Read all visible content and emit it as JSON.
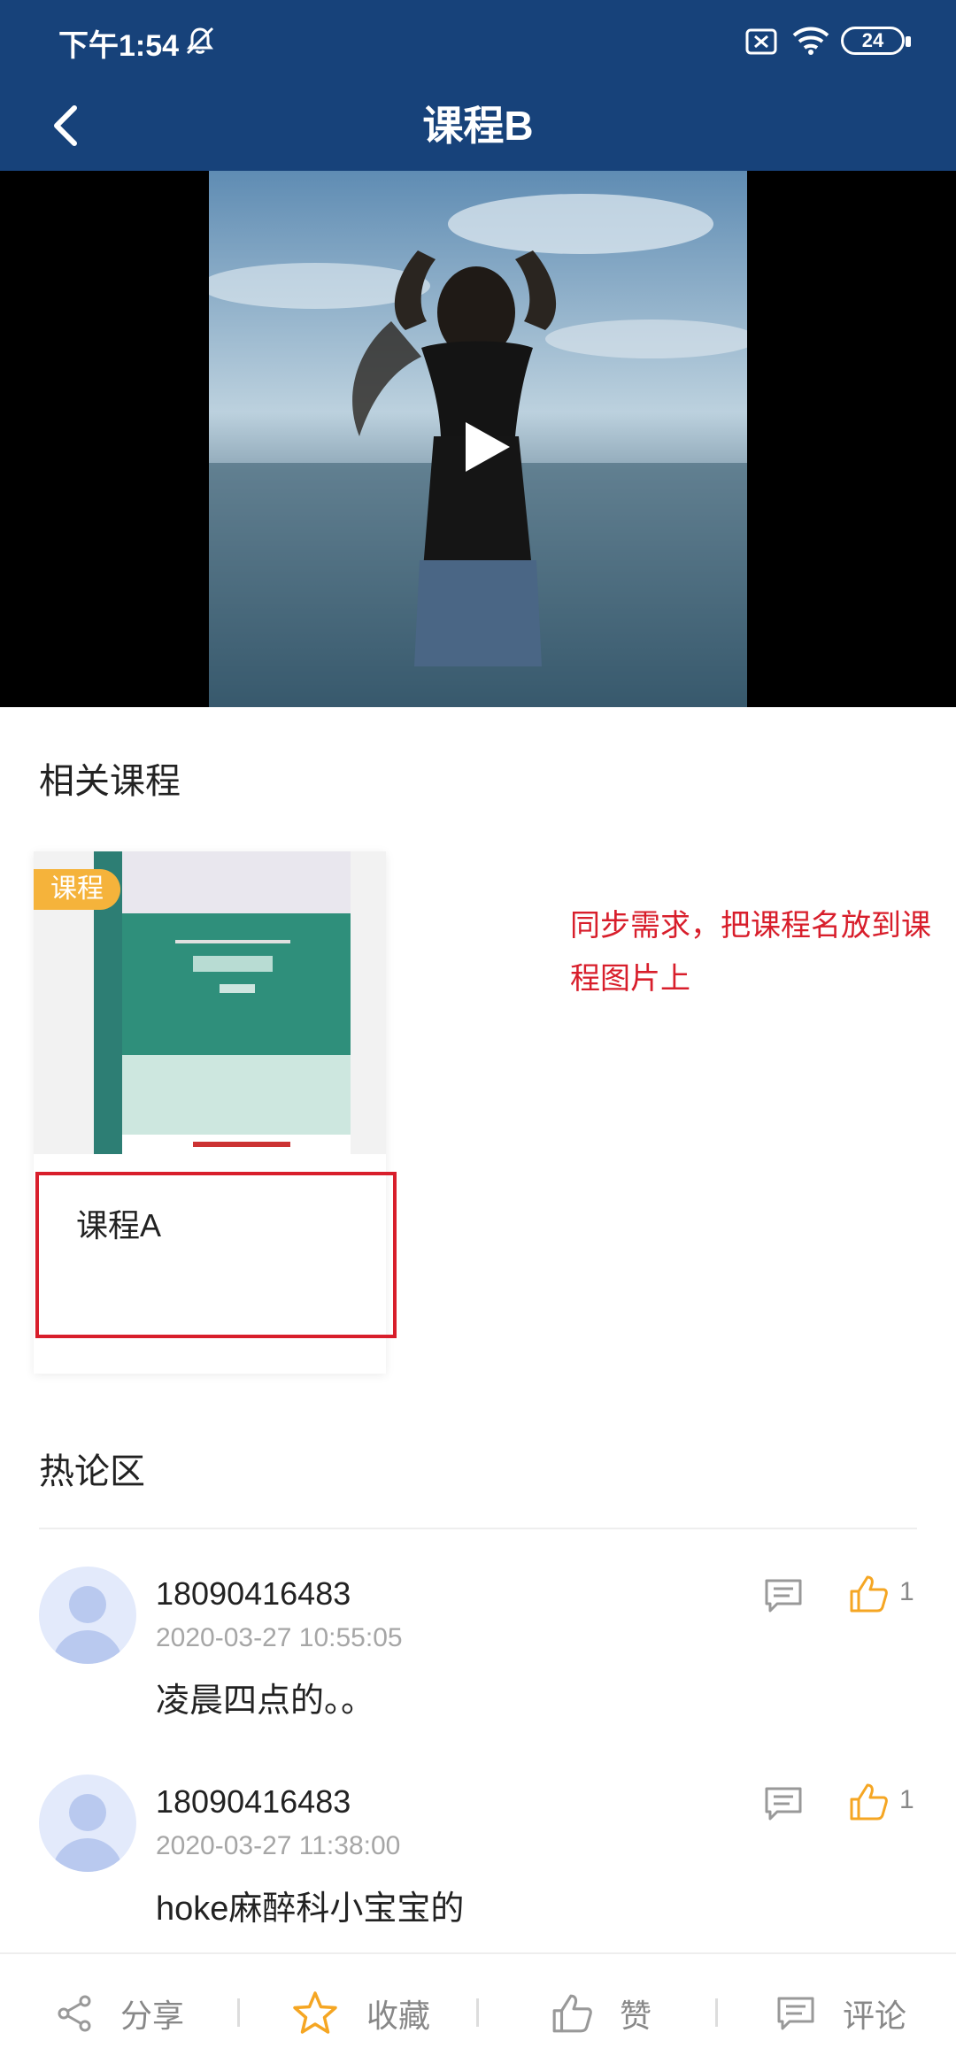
{
  "status": {
    "time": "下午1:54",
    "battery": "24"
  },
  "header": {
    "title": "课程B"
  },
  "related": {
    "title": "相关课程",
    "course": {
      "badge": "课程",
      "name": "课程A"
    },
    "annotation": "同步需求，把课程名放到课程图片上"
  },
  "hot": {
    "title": "热论区",
    "comments": [
      {
        "user": "18090416483",
        "time": "2020-03-27 10:55:05",
        "text": "凌晨四点的。。",
        "likes": "1"
      },
      {
        "user": "18090416483",
        "time": "2020-03-27 11:38:00",
        "text": "hoke麻醉科小宝宝的",
        "likes": "1"
      }
    ]
  },
  "bottom": {
    "share": "分享",
    "favorite": "收藏",
    "like": "赞",
    "comment": "评论"
  },
  "colors": {
    "header": "#17427a",
    "accent": "#f5a623",
    "highlight": "#d81e2b",
    "badge": "#f5b33b"
  },
  "icons": [
    "back-icon",
    "bell-off-icon",
    "sim-icon",
    "wifi-icon",
    "battery-icon",
    "play-icon",
    "reply-icon",
    "thumbs-up-icon",
    "share-icon",
    "star-icon",
    "comment-icon"
  ]
}
